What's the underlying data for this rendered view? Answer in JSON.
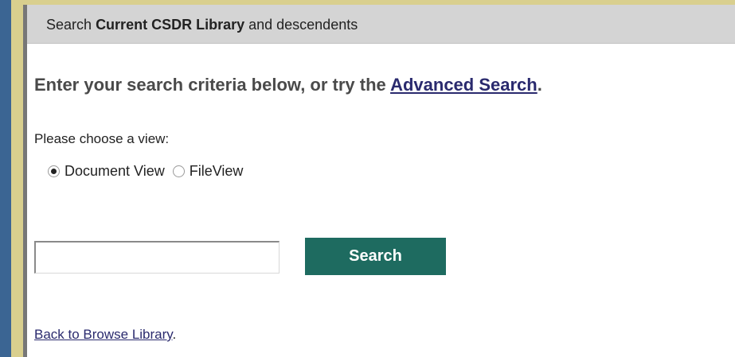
{
  "header": {
    "prefix": "Search",
    "library_name": "Current CSDR Library",
    "suffix": "and descendents"
  },
  "heading": {
    "text_before": "Enter your search criteria below, or try the",
    "advanced_link": "Advanced Search",
    "text_after": "."
  },
  "view_choice": {
    "label": "Please choose a view:",
    "options": [
      {
        "label": "Document View",
        "selected": true
      },
      {
        "label": "FileView",
        "selected": false
      }
    ]
  },
  "search": {
    "input_value": "",
    "button_label": "Search"
  },
  "footer": {
    "back_link": "Back to Browse Library",
    "back_suffix": "."
  },
  "colors": {
    "page_background": "#3b6593",
    "frame": "#d9cf8e",
    "header_background": "#d4d4d4",
    "button_background": "#1e6b60",
    "link_color": "#2a2a6e"
  }
}
